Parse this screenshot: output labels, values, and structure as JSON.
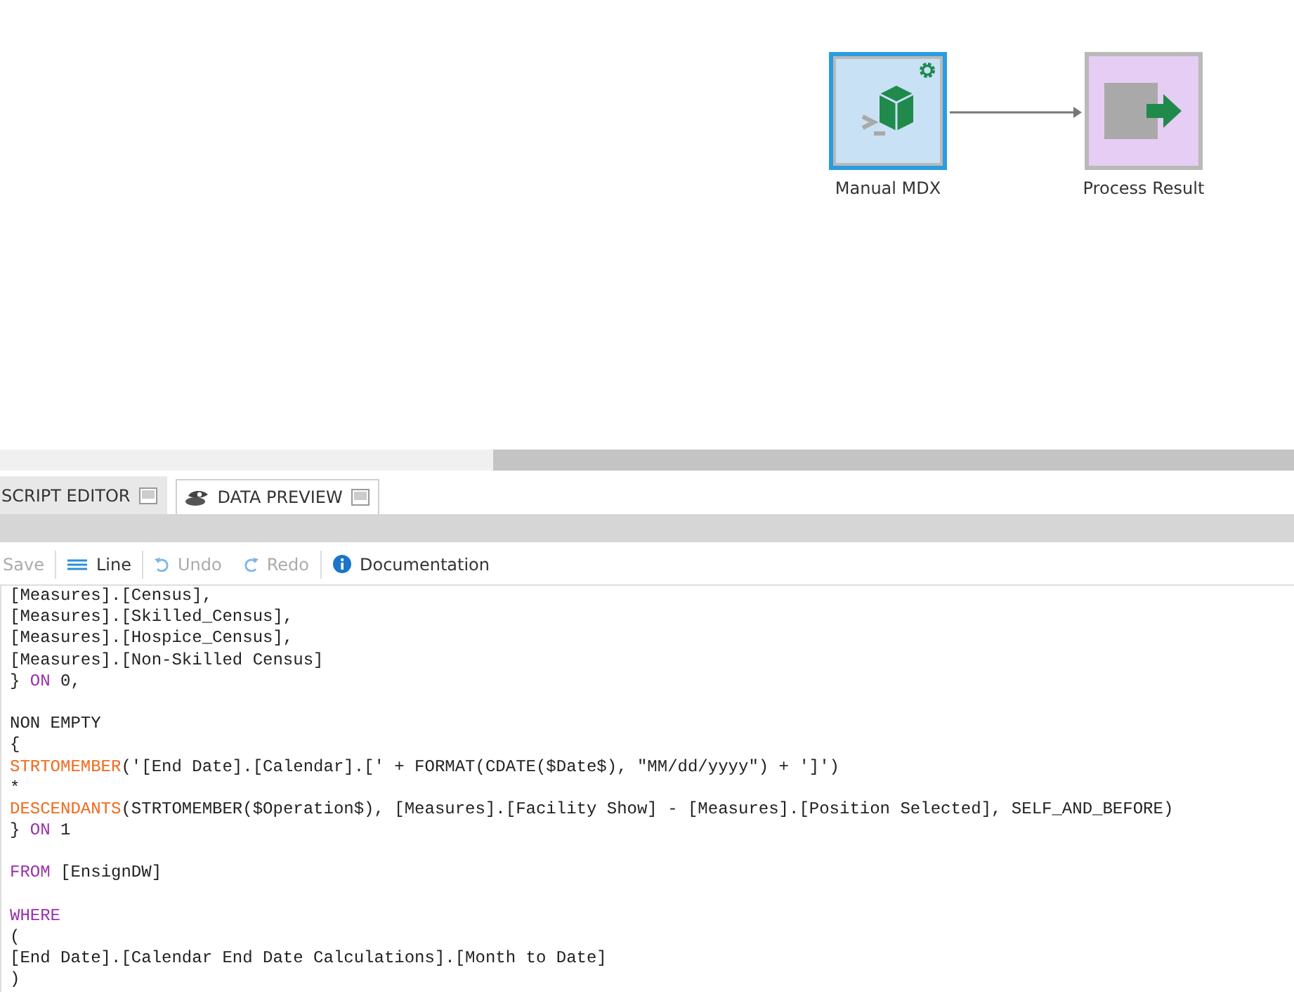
{
  "canvas": {
    "nodes": [
      {
        "label": "Manual MDX",
        "kind": "script",
        "selected": true
      },
      {
        "label": "Process Result",
        "kind": "result",
        "selected": false
      }
    ]
  },
  "tabs": [
    {
      "label": "SCRIPT EDITOR",
      "selected": true,
      "kind": "script"
    },
    {
      "label": "DATA PREVIEW",
      "selected": false,
      "kind": "preview"
    }
  ],
  "toolbar": [
    {
      "label": "Save",
      "kind": "save",
      "disabled": true
    },
    {
      "label": "Line",
      "kind": "line",
      "disabled": false
    },
    {
      "label": "Undo",
      "kind": "undo",
      "disabled": true
    },
    {
      "label": "Redo",
      "kind": "redo",
      "disabled": true
    },
    {
      "label": "Documentation",
      "kind": "info",
      "disabled": false
    }
  ],
  "code_lines": [
    {
      "segments": [
        {
          "text": "[Measures].[Census],",
          "kind": "plain"
        }
      ]
    },
    {
      "segments": [
        {
          "text": "[Measures].[Skilled_Census],",
          "kind": "plain"
        }
      ]
    },
    {
      "segments": [
        {
          "text": "[Measures].[Hospice_Census],",
          "kind": "plain"
        }
      ]
    },
    {
      "segments": [
        {
          "text": "[Measures].[Non-Skilled Census]",
          "kind": "plain"
        }
      ]
    },
    {
      "segments": [
        {
          "text": "} ",
          "kind": "plain"
        },
        {
          "text": "ON",
          "kind": "keyword"
        },
        {
          "text": " 0,",
          "kind": "plain"
        }
      ]
    },
    {
      "gap_before": true,
      "segments": [
        {
          "text": "NON EMPTY",
          "kind": "plain"
        }
      ]
    },
    {
      "segments": [
        {
          "text": "{",
          "kind": "plain"
        }
      ]
    },
    {
      "segments": [
        {
          "text": "STRTOMEMBER",
          "kind": "function"
        },
        {
          "text": "('[End Date].[Calendar].[' + FORMAT(CDATE($Date$), \"MM/dd/yyyy\") + ']')",
          "kind": "plain"
        }
      ]
    },
    {
      "segments": [
        {
          "text": "*",
          "kind": "plain"
        }
      ]
    },
    {
      "segments": [
        {
          "text": "DESCENDANTS",
          "kind": "function"
        },
        {
          "text": "(STRTOMEMBER($Operation$), [Measures].[Facility Show] - [Measures].[Position Selected], SELF_AND_BEFORE)",
          "kind": "plain"
        }
      ]
    },
    {
      "segments": [
        {
          "text": "} ",
          "kind": "plain"
        },
        {
          "text": "ON",
          "kind": "keyword"
        },
        {
          "text": " 1",
          "kind": "plain"
        }
      ]
    },
    {
      "gap_before": true,
      "segments": [
        {
          "text": "FROM",
          "kind": "keyword"
        },
        {
          "text": " [EnsignDW]",
          "kind": "plain"
        }
      ]
    },
    {
      "gap_before": true,
      "segments": [
        {
          "text": "WHERE",
          "kind": "keyword"
        }
      ]
    },
    {
      "segments": [
        {
          "text": "(",
          "kind": "plain"
        }
      ]
    },
    {
      "segments": [
        {
          "text": "[End Date].[Calendar End Date Calculations].[Month to Date]",
          "kind": "plain"
        }
      ]
    },
    {
      "segments": [
        {
          "text": ")",
          "kind": "plain"
        }
      ]
    }
  ]
}
